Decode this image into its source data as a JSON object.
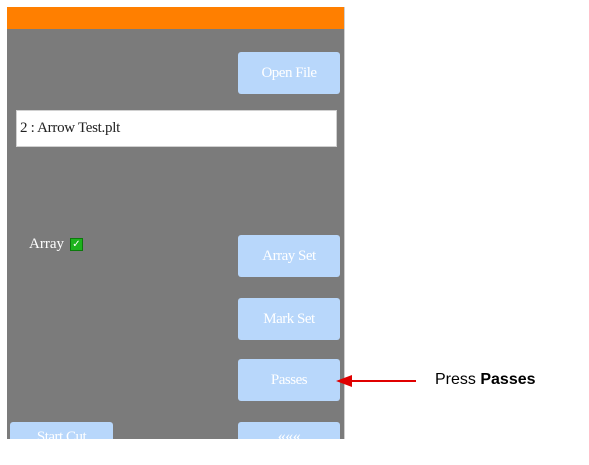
{
  "buttons": {
    "open_file": "Open File",
    "array_set": "Array Set",
    "mark_set": "Mark Set",
    "passes": "Passes",
    "back": "«««",
    "start_cut": "Start Cut"
  },
  "file_field": {
    "value": "2 : Arrow Test.plt"
  },
  "array": {
    "label": "Array",
    "checked": true
  },
  "callout": {
    "prefix": "Press ",
    "bold": "Passes"
  },
  "colors": {
    "panel": "#7b7b7b",
    "top_bar": "#ff7f00",
    "button": "#b8d7fb",
    "checkbox": "#1db31d",
    "arrow": "#e00000"
  },
  "icons": {
    "back": "triple-chevron-left-icon",
    "checkbox": "checkmark-icon",
    "callout": "arrow-left-icon"
  }
}
